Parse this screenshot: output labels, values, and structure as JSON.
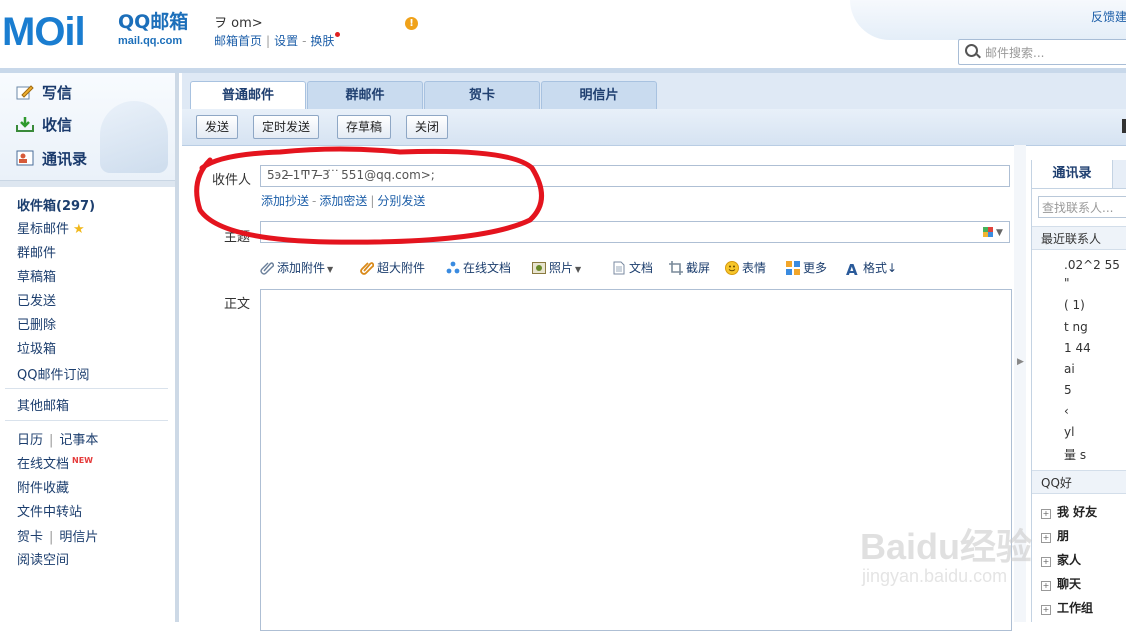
{
  "brand": {
    "logo_word": "MOil",
    "logo_cn": "QQ邮箱",
    "logo_url": "mail.qq.com"
  },
  "header": {
    "account": "ヲ                          om>",
    "links": [
      "邮箱首页",
      "设置",
      "换肤"
    ],
    "feedback": "反馈建",
    "search_placeholder": "邮件搜索..."
  },
  "quick_actions": [
    "写信",
    "收信",
    "通讯录"
  ],
  "folders": {
    "inbox": "收件箱(297)",
    "starred": "星标邮件",
    "group_mail": "群邮件",
    "drafts": "草稿箱",
    "sent": "已发送",
    "deleted": "已删除",
    "spam": "垃圾箱",
    "subscription": "QQ邮件订阅",
    "other_mailbox": "其他邮箱",
    "calendar": "日历",
    "notes": "记事本",
    "online_docs": "在线文档",
    "new_tag": "NEW",
    "attachments": "附件收藏",
    "file_transfer": "文件中转站",
    "greeting_card": "贺卡",
    "postcard": "明信片",
    "reading_space": "阅读空间"
  },
  "tabs": [
    "普通邮件",
    "群邮件",
    "贺卡",
    "明信片"
  ],
  "toolbar": {
    "send": "发送",
    "scheduled": "定时发送",
    "save_draft": "存草稿",
    "close": "关闭"
  },
  "form": {
    "recipient_label": "收件人",
    "recipient_value": "5э2       ̶1Ͳ7       ̶3͘  ͘  ͘ 551@qq.com>;",
    "add_cc": "添加抄送",
    "add_bcc": "添加密送",
    "separate_send": "分别发送",
    "subject_label": "主题",
    "body_label": "正文"
  },
  "attach_bar": [
    "添加附件",
    "超大附件",
    "在线文档",
    "照片",
    "文档",
    "截屏",
    "表情",
    "更多",
    "格式"
  ],
  "contacts": {
    "tab": "通讯录",
    "search_placeholder": "查找联系人...",
    "recent_title": "最近联系人",
    "recent_items": [
      ".02^2  55",
      "\"",
      "(     1)",
      "t     ng",
      "1      44",
      "       ai",
      "          5",
      "  ‹",
      "yl",
      "量    s"
    ],
    "qq_title": "QQ好",
    "groups": [
      "我    好友",
      "朋    ",
      "家人",
      "聊天",
      "工作组"
    ]
  },
  "watermark": {
    "text": "Baidu经验",
    "url": "jingyan.baidu.com"
  },
  "colors": {
    "accent": "#1c5ea8",
    "panel": "#dfe9f5",
    "annotation": "#e4141e"
  }
}
